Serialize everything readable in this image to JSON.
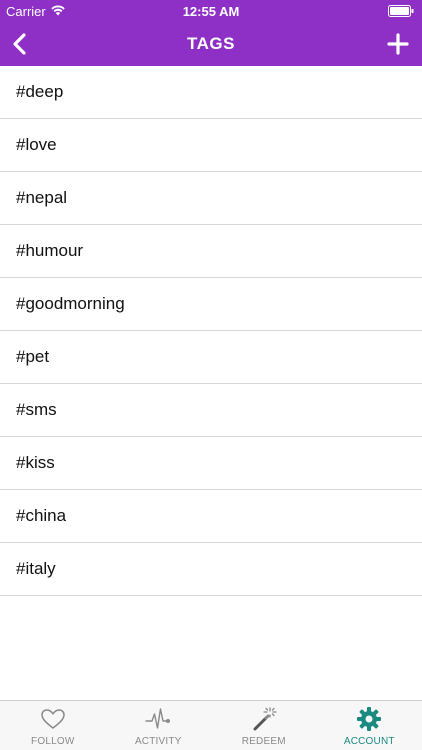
{
  "status_bar": {
    "carrier": "Carrier",
    "time": "12:55 AM"
  },
  "nav": {
    "title": "TAGS"
  },
  "tags": [
    "#deep",
    "#love",
    "#nepal",
    "#humour",
    "#goodmorning",
    "#pet",
    "#sms",
    "#kiss",
    "#china",
    "#italy"
  ],
  "tab_bar": {
    "follow": "FOLLOW",
    "activity": "ACTIVITY",
    "redeem": "REDEEM",
    "account": "ACCOUNT"
  },
  "colors": {
    "header": "#8e30c6",
    "active_tab": "#1a8a80",
    "inactive_tab": "#8a8a8a"
  }
}
